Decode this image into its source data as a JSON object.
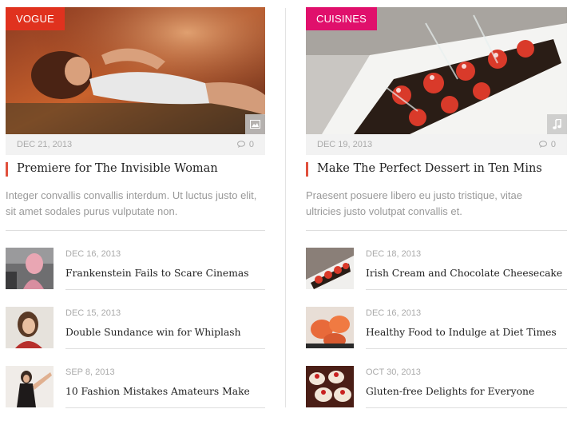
{
  "left": {
    "category": "VOGUE",
    "category_color": "#e0321e",
    "date": "DEC 21, 2013",
    "comments": "0",
    "format_icon": "image-icon",
    "title": "Premiere for The Invisible Woman",
    "excerpt": "Integer convallis convallis interdum. Ut luctus justo elit, sit amet sodales purus vulputate non.",
    "items": [
      {
        "date": "DEC 16, 2013",
        "title": "Frankenstein Fails to Scare Cinemas"
      },
      {
        "date": "DEC 15, 2013",
        "title": "Double Sundance win for Whiplash"
      },
      {
        "date": "SEP 8, 2013",
        "title": "10 Fashion Mistakes Amateurs Make"
      }
    ]
  },
  "right": {
    "category": "CUISINES",
    "category_color": "#e0106c",
    "date": "DEC 19, 2013",
    "comments": "0",
    "format_icon": "music-icon",
    "title": "Make The Perfect Dessert in Ten Mins",
    "excerpt": "Praesent posuere libero eu justo tristique, vitae ultricies justo volutpat convallis et.",
    "items": [
      {
        "date": "DEC 18, 2013",
        "title": "Irish Cream and Chocolate Cheesecake"
      },
      {
        "date": "DEC 16, 2013",
        "title": "Healthy Food to Indulge at Diet Times"
      },
      {
        "date": "OCT 30, 2013",
        "title": "Gluten-free Delights for Everyone"
      }
    ]
  },
  "accent_color": "#e0503c"
}
